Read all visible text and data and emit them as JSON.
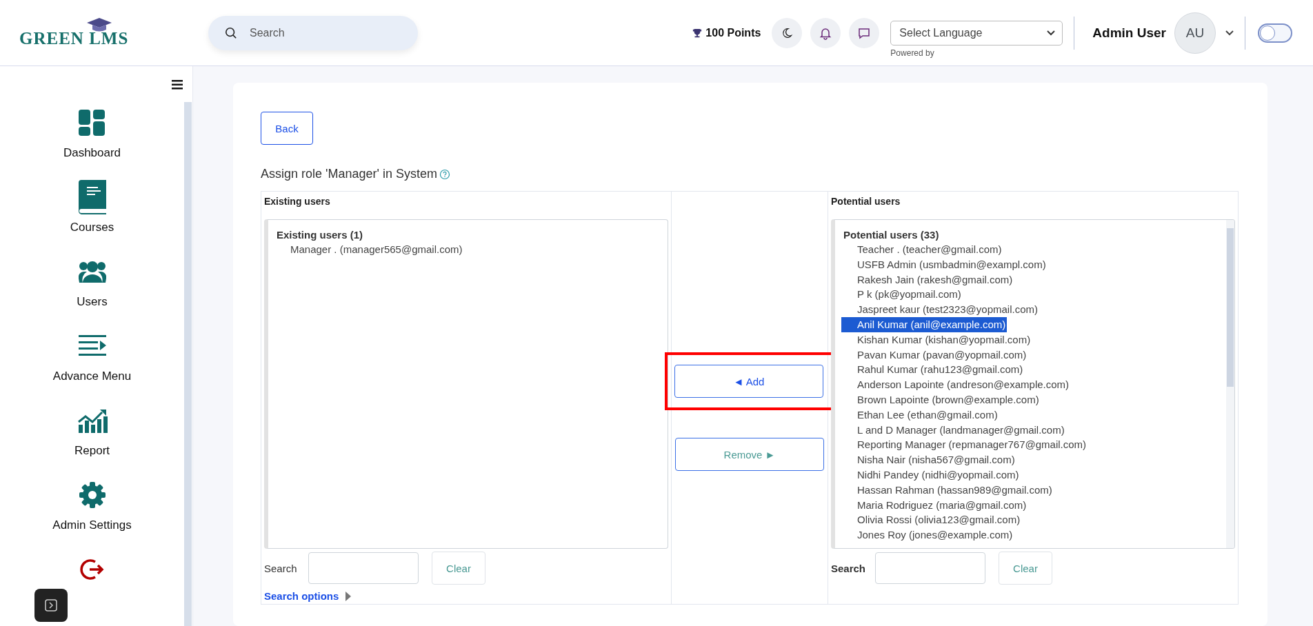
{
  "header": {
    "logo": "GREEN LMS",
    "search": {
      "placeholder": "Search"
    },
    "points": "100 Points",
    "language_select": {
      "value": "Select Language",
      "note": "Powered by"
    },
    "user": {
      "name": "Admin User",
      "initials": "AU"
    },
    "theme_toggle": {
      "on": false
    }
  },
  "sidebar": {
    "items": [
      {
        "kind": "dashboard",
        "label": "Dashboard"
      },
      {
        "kind": "courses",
        "label": "Courses"
      },
      {
        "kind": "users",
        "label": "Users"
      },
      {
        "kind": "menu",
        "label": "Advance Menu"
      },
      {
        "kind": "report",
        "label": "Report"
      },
      {
        "kind": "settings",
        "label": "Admin Settings"
      },
      {
        "kind": "logout"
      }
    ]
  },
  "page": {
    "back": "Back",
    "title": "Assign role 'Manager' in System",
    "existing": {
      "heading": "Existing users",
      "group": "Existing users (1)",
      "users": [
        {
          "label": "Manager . (manager565@gmail.com)",
          "selected": false
        }
      ],
      "search_label": "Search",
      "clear": "Clear",
      "search_options": "Search options"
    },
    "actions": {
      "add": "◄ Add",
      "add_highlighted": true,
      "remove": "Remove ►"
    },
    "potential": {
      "heading": "Potential users",
      "group": "Potential users (33)",
      "users": [
        {
          "label": "Teacher . (teacher@gmail.com)",
          "selected": false
        },
        {
          "label": "USFB Admin (usmbadmin@exampl.com)",
          "selected": false
        },
        {
          "label": "Rakesh Jain (rakesh@gmail.com)",
          "selected": false
        },
        {
          "label": "P k (pk@yopmail.com)",
          "selected": false
        },
        {
          "label": "Jaspreet kaur (test2323@yopmail.com)",
          "selected": false
        },
        {
          "label": "Anil Kumar (anil@example.com)",
          "selected": true
        },
        {
          "label": "Kishan Kumar (kishan@yopmail.com)",
          "selected": false
        },
        {
          "label": "Pavan Kumar (pavan@yopmail.com)",
          "selected": false
        },
        {
          "label": "Rahul Kumar (rahu123@gmail.com)",
          "selected": false
        },
        {
          "label": "Anderson Lapointe (andreson@example.com)",
          "selected": false
        },
        {
          "label": "Brown Lapointe (brown@example.com)",
          "selected": false
        },
        {
          "label": "Ethan Lee (ethan@gmail.com)",
          "selected": false
        },
        {
          "label": "L and D Manager (landmanager@gmail.com)",
          "selected": false
        },
        {
          "label": "Reporting Manager (repmanager767@gmail.com)",
          "selected": false
        },
        {
          "label": "Nisha Nair (nisha567@gmail.com)",
          "selected": false
        },
        {
          "label": "Nidhi Pandey (nidhi@yopmail.com)",
          "selected": false
        },
        {
          "label": "Hassan Rahman (hassan989@gmail.com)",
          "selected": false
        },
        {
          "label": "Maria Rodriguez (maria@gmail.com)",
          "selected": false
        },
        {
          "label": "Olivia Rossi (olivia123@gmail.com)",
          "selected": false
        },
        {
          "label": "Jones Roy (jones@example.com)",
          "selected": false
        }
      ],
      "search_label": "Search",
      "clear": "Clear"
    }
  }
}
